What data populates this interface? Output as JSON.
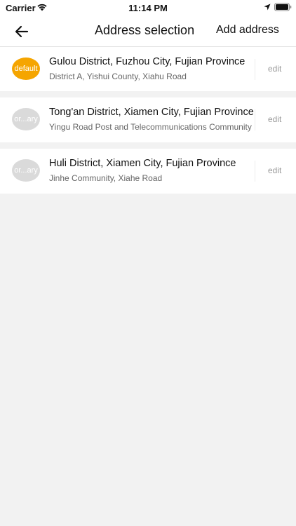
{
  "status_bar": {
    "carrier": "Carrier",
    "time": "11:14 PM",
    "icons": [
      "wifi-icon",
      "location-arrow-icon",
      "battery-icon"
    ]
  },
  "nav": {
    "back_icon": "arrow-left-icon",
    "title": "Address selection",
    "add_label": "Add address"
  },
  "colors": {
    "default_tag": "#f5a500",
    "ordinary_tag": "#dadada",
    "background": "#f2f2f2"
  },
  "addresses": [
    {
      "tag": "default",
      "title": "Gulou District, Fuzhou City, Fujian Province",
      "detail": "District A, Yishui County, Xiahu Road",
      "edit_label": "edit"
    },
    {
      "tag": "or...ary",
      "title": "Tong'an District, Xiamen City, Fujian Province",
      "detail": "Yingu Road Post and Telecommunications Community",
      "edit_label": "edit"
    },
    {
      "tag": "or...ary",
      "title": "Huli District, Xiamen City, Fujian Province",
      "detail": "Jinhe Community, Xiahe Road",
      "edit_label": "edit"
    }
  ]
}
